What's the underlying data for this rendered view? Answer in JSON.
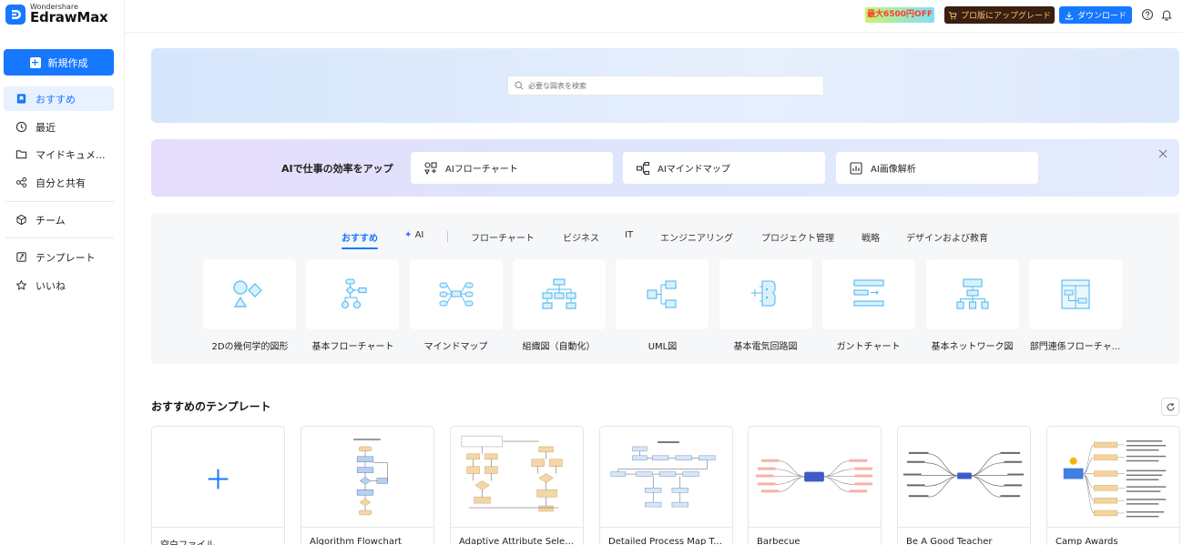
{
  "logo": {
    "brand": "Wondershare",
    "product": "EdrawMax"
  },
  "sidebar": {
    "new_button": "新規作成",
    "items": [
      {
        "label": "おすすめ",
        "icon": "bookmark-icon"
      },
      {
        "label": "最近",
        "icon": "clock-icon"
      },
      {
        "label": "マイドキュメ...",
        "icon": "folder-icon"
      },
      {
        "label": "自分と共有",
        "icon": "share-icon"
      },
      {
        "label": "チーム",
        "icon": "cube-icon"
      },
      {
        "label": "テンプレート",
        "icon": "template-icon"
      },
      {
        "label": "いいね",
        "icon": "star-icon"
      }
    ]
  },
  "topbar": {
    "promo": "最大6500円OFF",
    "upgrade": "プロ版にアップグレード",
    "download": "ダウンロード"
  },
  "search": {
    "placeholder": "必要な図表を検索"
  },
  "ai": {
    "title": "AIで仕事の効率をアップ",
    "cards": [
      {
        "label": "AIフローチャート",
        "icon": "flowchart-ai-icon"
      },
      {
        "label": "AIマインドマップ",
        "icon": "mindmap-ai-icon"
      },
      {
        "label": "AI画像解析",
        "icon": "image-analysis-icon"
      }
    ]
  },
  "categories": {
    "tabs": [
      "おすすめ",
      "AI",
      "フローチャート",
      "ビジネス",
      "IT",
      "エンジニアリング",
      "プロジェクト管理",
      "戦略",
      "デザインおよび教育"
    ],
    "tiles": [
      "2Dの幾何学的図形",
      "基本フローチャート",
      "マインドマップ",
      "組織図（自動化）",
      "UML図",
      "基本電気回路図",
      "ガントチャート",
      "基本ネットワーク図",
      "部門連係フローチャ..."
    ]
  },
  "templates": {
    "title": "おすすめのテンプレート",
    "items": [
      "空白ファイル",
      "Algorithm Flowchart",
      "Adaptive Attribute Selec...",
      "Detailed Process Map Te...",
      "Barbecue",
      "Be A Good Teacher",
      "Camp Awards"
    ]
  },
  "colors": {
    "accent": "#1677ff",
    "icon": "#55b8f0"
  }
}
